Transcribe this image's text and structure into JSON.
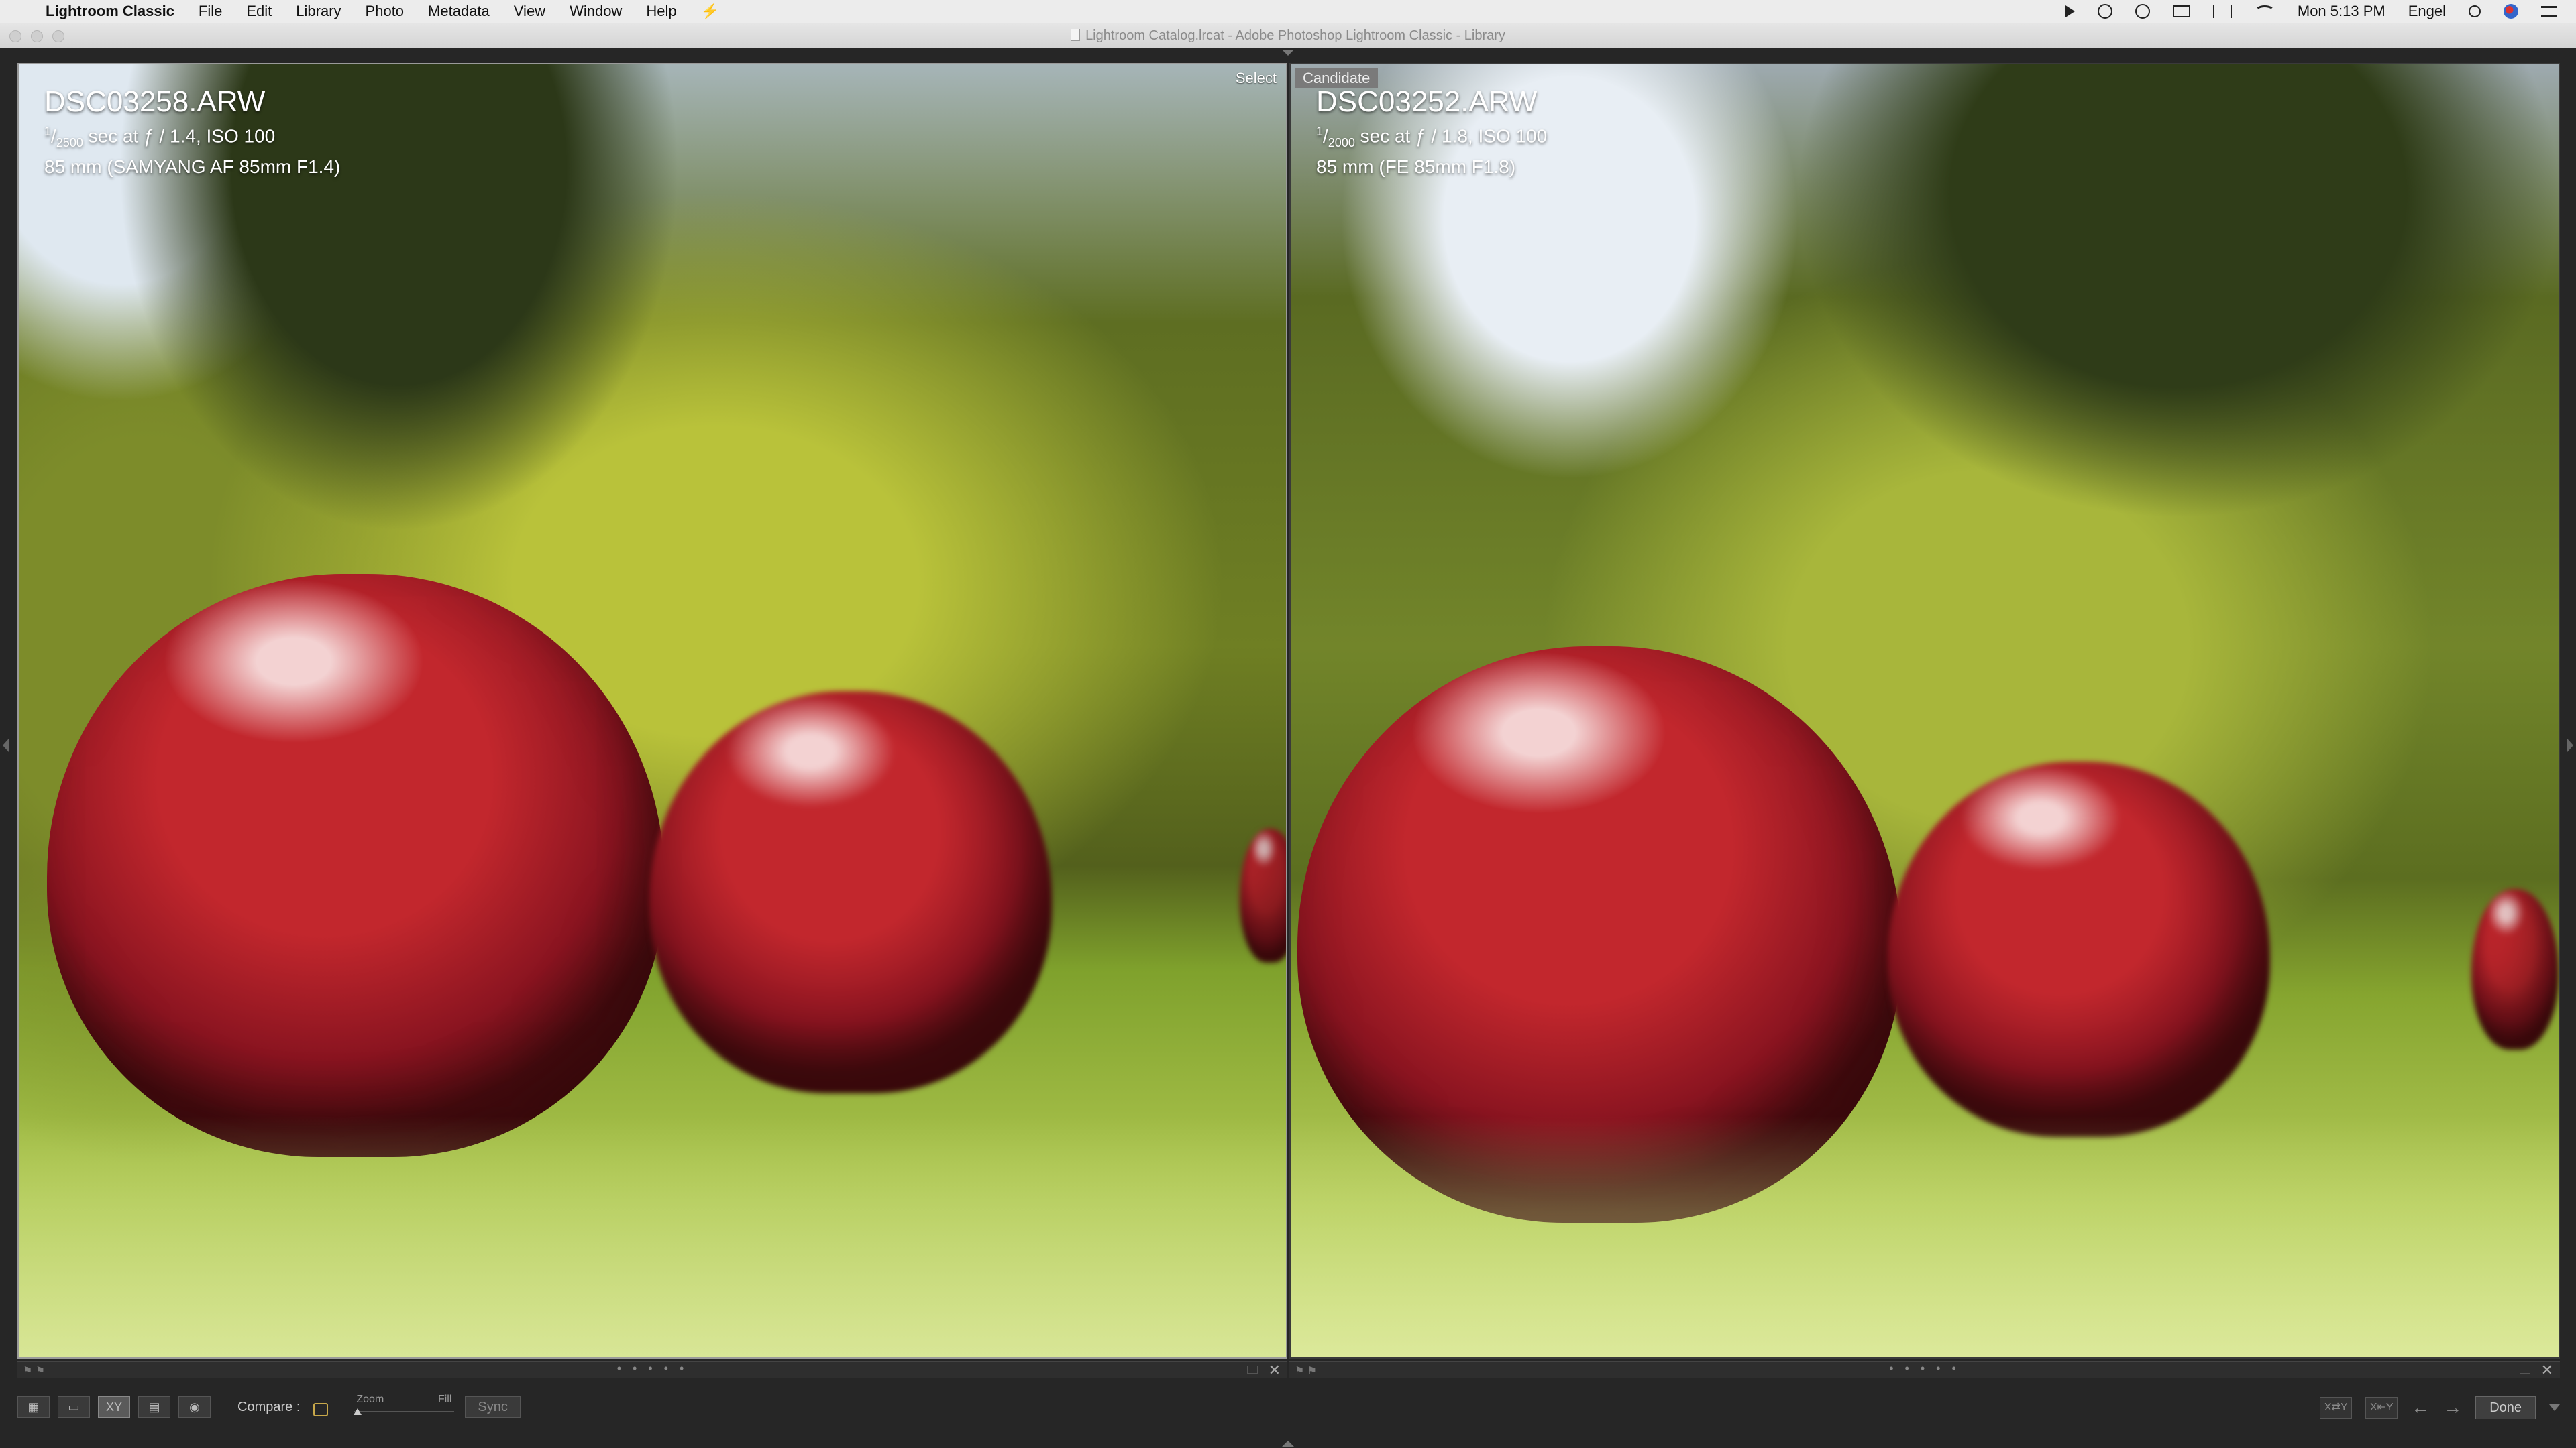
{
  "menubar": {
    "app_name": "Lightroom Classic",
    "items": [
      "File",
      "Edit",
      "Library",
      "Photo",
      "Metadata",
      "View",
      "Window",
      "Help"
    ],
    "clock": "Mon 5:13 PM",
    "user": "Engel"
  },
  "window": {
    "title": "Lightroom Catalog.lrcat - Adobe Photoshop Lightroom Classic - Library"
  },
  "left_pane": {
    "badge": "Select",
    "filename": "DSC03258.ARW",
    "shutter_num": "1",
    "shutter_den": "2500",
    "exposure_rest": " sec at ƒ / 1.4, ISO 100",
    "lens": "85 mm (SAMYANG AF 85mm F1.4)"
  },
  "right_pane": {
    "badge": "Candidate",
    "filename": "DSC03252.ARW",
    "shutter_num": "1",
    "shutter_den": "2000",
    "exposure_rest": " sec at ƒ / 1.8, ISO 100",
    "lens": "85 mm (FE 85mm F1.8)"
  },
  "strip": {
    "dots": "• • • • •",
    "close": "✕"
  },
  "toolbar": {
    "compare_label": "Compare :",
    "zoom_label": "Zoom",
    "fill_label": "Fill",
    "sync_label": "Sync",
    "done_label": "Done",
    "view_modes": [
      "grid",
      "loupe",
      "compare",
      "survey",
      "people"
    ],
    "active_mode": "compare"
  },
  "colors": {
    "lock": "#c8a84a",
    "select_border": "#9a9a9a"
  }
}
